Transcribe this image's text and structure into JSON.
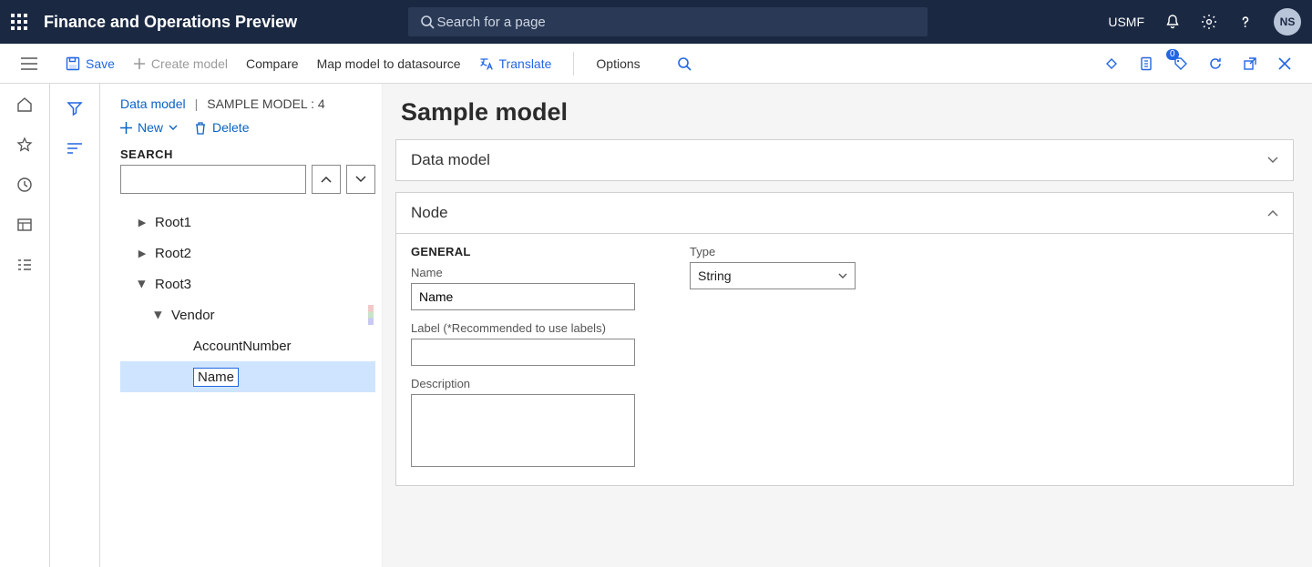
{
  "topnav": {
    "app_title": "Finance and Operations Preview",
    "search_placeholder": "Search for a page",
    "company": "USMF",
    "avatar_initials": "NS"
  },
  "cmdbar": {
    "save": "Save",
    "create_model": "Create model",
    "compare": "Compare",
    "map_model": "Map model to datasource",
    "translate": "Translate",
    "options": "Options",
    "badge_count": "0"
  },
  "breadcrumb": {
    "link": "Data model",
    "current": "SAMPLE MODEL : 4"
  },
  "tree_toolbar": {
    "new_label": "New",
    "delete_label": "Delete",
    "search_label": "SEARCH"
  },
  "tree": {
    "items": [
      {
        "label": "Root1"
      },
      {
        "label": "Root2"
      },
      {
        "label": "Root3"
      },
      {
        "label": "Vendor"
      },
      {
        "label": "AccountNumber"
      },
      {
        "label": "Name"
      }
    ]
  },
  "page": {
    "title": "Sample model"
  },
  "panels": {
    "data_model_title": "Data model",
    "node_title": "Node",
    "general_label": "GENERAL",
    "name_label": "Name",
    "name_value": "Name",
    "label_field_label": "Label (*Recommended to use labels)",
    "label_value": "",
    "description_label": "Description",
    "description_value": "",
    "type_label": "Type",
    "type_value": "String"
  }
}
